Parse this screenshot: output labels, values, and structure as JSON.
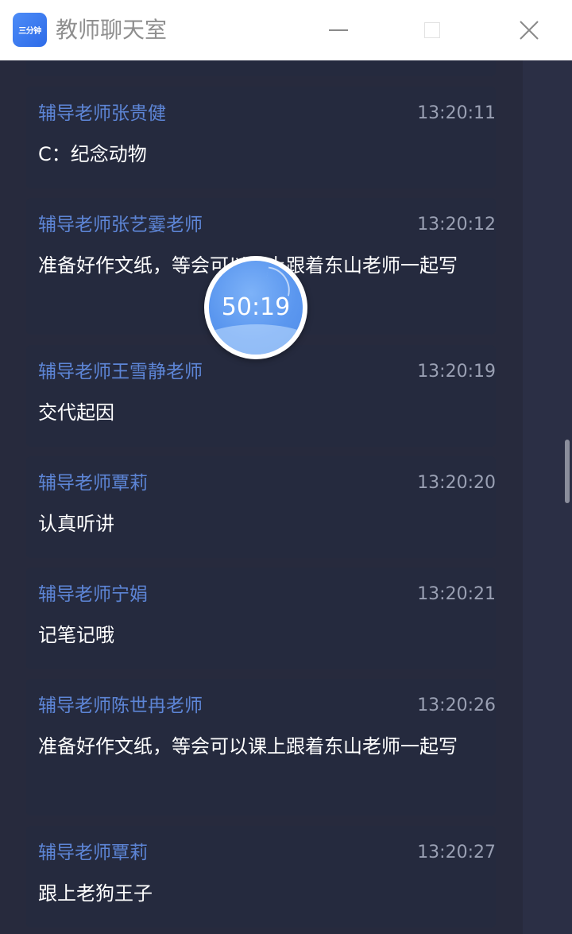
{
  "window": {
    "title": "教师聊天室",
    "logo_text": "三分钟"
  },
  "timer": {
    "value": "50:19"
  },
  "messages": [
    {
      "name": "辅导老师张贵健",
      "time": "13:20:11",
      "text": "C：纪念动物"
    },
    {
      "name": "辅导老师张艺霎老师",
      "time": "13:20:12",
      "text": "准备好作文纸，等会可以课上跟着东山老师一起写"
    },
    {
      "name": "辅导老师王雪静老师",
      "time": "13:20:19",
      "text": "交代起因"
    },
    {
      "name": "辅导老师覃莉",
      "time": "13:20:20",
      "text": "认真听讲"
    },
    {
      "name": "辅导老师宁娟",
      "time": "13:20:21",
      "text": "记笔记哦"
    },
    {
      "name": "辅导老师陈世冉老师",
      "time": "13:20:26",
      "text": "准备好作文纸，等会可以课上跟着东山老师一起写"
    },
    {
      "name": "辅导老师覃莉",
      "time": "13:20:27",
      "text": "跟上老狗王子"
    }
  ],
  "colors": {
    "background": "#2b2f45",
    "card": "#252a3e",
    "name": "#5d85d6",
    "time": "#9aa0b3",
    "text": "#ffffff",
    "timer_accent": "#5b97ef"
  }
}
